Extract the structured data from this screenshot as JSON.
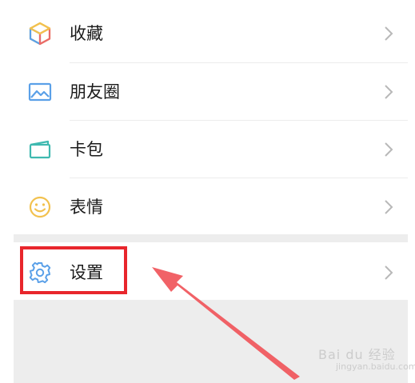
{
  "menu": {
    "items": [
      {
        "label": "收藏",
        "icon": "favorites-cube-icon"
      },
      {
        "label": "朋友圈",
        "icon": "moments-photo-icon"
      },
      {
        "label": "卡包",
        "icon": "card-wallet-icon"
      },
      {
        "label": "表情",
        "icon": "sticker-smile-icon"
      }
    ],
    "settings": {
      "label": "设置",
      "icon": "gear-icon"
    }
  },
  "annotation": {
    "highlight_color": "#e8262c",
    "arrow_color": "#f0555a"
  },
  "watermark": {
    "text": "Bai du 经验",
    "sub": "jingyan.baidu.com"
  }
}
